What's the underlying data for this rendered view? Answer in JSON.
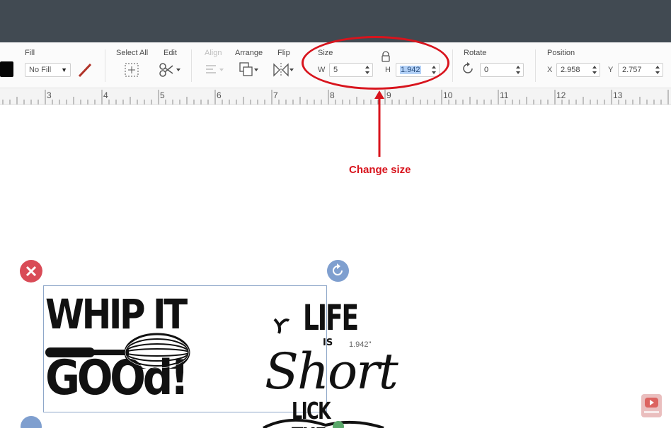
{
  "toolbar": {
    "fill": {
      "label": "Fill",
      "value": "No Fill"
    },
    "select_all": {
      "label": "Select All"
    },
    "edit": {
      "label": "Edit"
    },
    "align": {
      "label": "Align"
    },
    "arrange": {
      "label": "Arrange"
    },
    "flip": {
      "label": "Flip"
    },
    "size": {
      "label": "Size",
      "w_label": "W",
      "w_value": "5",
      "h_label": "H",
      "h_value": "1.942"
    },
    "rotate": {
      "label": "Rotate",
      "value": "0"
    },
    "position": {
      "label": "Position",
      "x_label": "X",
      "x_value": "2.958",
      "y_label": "Y",
      "y_value": "2.757"
    }
  },
  "ruler": {
    "labels": [
      "3",
      "4",
      "5",
      "6",
      "7",
      "8",
      "9",
      "10",
      "11",
      "12",
      "13"
    ]
  },
  "annotation": {
    "text": "Change size"
  },
  "canvas": {
    "design_left": {
      "line1": "WHIP IT",
      "line2": "GOOd!"
    },
    "design_right": {
      "line1": "LIFE",
      "line2": "IS",
      "line3": "Short",
      "line4": "LICK THE"
    },
    "dimension_label": "1.942\""
  },
  "colors": {
    "annotation": "#d8141d",
    "topbar": "#414a52",
    "selection": "#8ea7c9",
    "delete_handle": "#d94b57",
    "rotate_handle": "#7f9fcf"
  }
}
